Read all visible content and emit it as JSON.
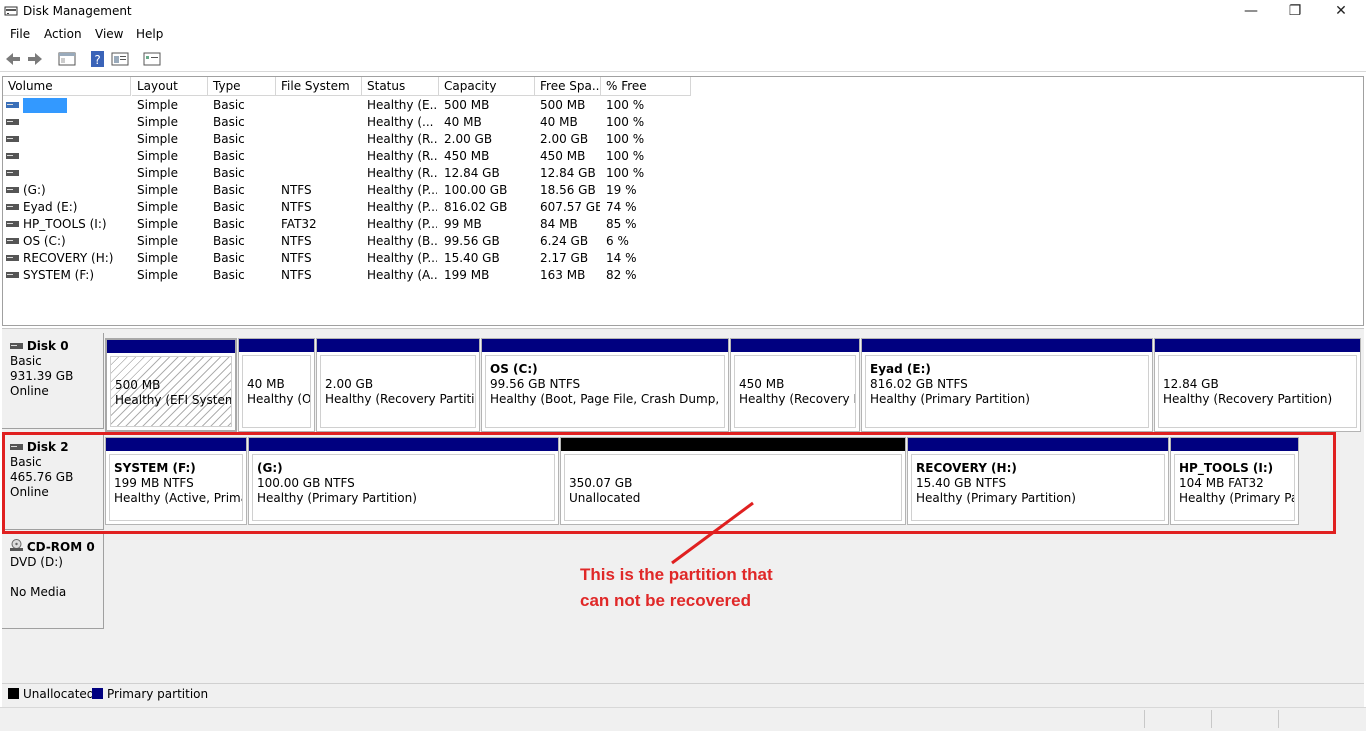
{
  "window": {
    "title": "Disk Management",
    "minimize": "—",
    "maximize": "❐",
    "close": "✕"
  },
  "menu": [
    "File",
    "Action",
    "View",
    "Help"
  ],
  "columns": [
    "Volume",
    "Layout",
    "Type",
    "File System",
    "Status",
    "Capacity",
    "Free Spa...",
    "% Free"
  ],
  "volumes": [
    {
      "volume": "",
      "layout": "Simple",
      "type": "Basic",
      "fs": "",
      "status": "Healthy (E...",
      "capacity": "500 MB",
      "free": "500 MB",
      "pct": "100 %"
    },
    {
      "volume": "",
      "layout": "Simple",
      "type": "Basic",
      "fs": "",
      "status": "Healthy (...",
      "capacity": "40 MB",
      "free": "40 MB",
      "pct": "100 %"
    },
    {
      "volume": "",
      "layout": "Simple",
      "type": "Basic",
      "fs": "",
      "status": "Healthy (R...",
      "capacity": "2.00 GB",
      "free": "2.00 GB",
      "pct": "100 %"
    },
    {
      "volume": "",
      "layout": "Simple",
      "type": "Basic",
      "fs": "",
      "status": "Healthy (R...",
      "capacity": "450 MB",
      "free": "450 MB",
      "pct": "100 %"
    },
    {
      "volume": "",
      "layout": "Simple",
      "type": "Basic",
      "fs": "",
      "status": "Healthy (R...",
      "capacity": "12.84 GB",
      "free": "12.84 GB",
      "pct": "100 %"
    },
    {
      "volume": "(G:)",
      "layout": "Simple",
      "type": "Basic",
      "fs": "NTFS",
      "status": "Healthy (P...",
      "capacity": "100.00 GB",
      "free": "18.56 GB",
      "pct": "19 %"
    },
    {
      "volume": "Eyad (E:)",
      "layout": "Simple",
      "type": "Basic",
      "fs": "NTFS",
      "status": "Healthy (P...",
      "capacity": "816.02 GB",
      "free": "607.57 GB",
      "pct": "74 %"
    },
    {
      "volume": "HP_TOOLS (I:)",
      "layout": "Simple",
      "type": "Basic",
      "fs": "FAT32",
      "status": "Healthy (P...",
      "capacity": "99 MB",
      "free": "84 MB",
      "pct": "85 %"
    },
    {
      "volume": "OS (C:)",
      "layout": "Simple",
      "type": "Basic",
      "fs": "NTFS",
      "status": "Healthy (B...",
      "capacity": "99.56 GB",
      "free": "6.24 GB",
      "pct": "6 %"
    },
    {
      "volume": "RECOVERY (H:)",
      "layout": "Simple",
      "type": "Basic",
      "fs": "NTFS",
      "status": "Healthy (P...",
      "capacity": "15.40 GB",
      "free": "2.17 GB",
      "pct": "14 %"
    },
    {
      "volume": "SYSTEM (F:)",
      "layout": "Simple",
      "type": "Basic",
      "fs": "NTFS",
      "status": "Healthy (A...",
      "capacity": "199 MB",
      "free": "163 MB",
      "pct": "82 %"
    }
  ],
  "disks": [
    {
      "name": "Disk 0",
      "type": "Basic",
      "size": "931.39 GB",
      "state": "Online",
      "partitions": [
        {
          "title": "",
          "line1": "500 MB",
          "line2": "Healthy (EFI System Pa"
        },
        {
          "title": "",
          "line1": "40 MB",
          "line2": "Healthy (OE"
        },
        {
          "title": "",
          "line1": "2.00 GB",
          "line2": "Healthy (Recovery Partition)"
        },
        {
          "title": "OS  (C:)",
          "line1": "99.56 GB NTFS",
          "line2": "Healthy (Boot, Page File, Crash Dump, Prima"
        },
        {
          "title": "",
          "line1": "450 MB",
          "line2": "Healthy (Recovery Par"
        },
        {
          "title": "Eyad  (E:)",
          "line1": "816.02 GB NTFS",
          "line2": "Healthy (Primary Partition)"
        },
        {
          "title": "",
          "line1": "12.84 GB",
          "line2": "Healthy (Recovery Partition)"
        }
      ]
    },
    {
      "name": "Disk 2",
      "type": "Basic",
      "size": "465.76 GB",
      "state": "Online",
      "partitions": [
        {
          "title": "SYSTEM  (F:)",
          "line1": "199 MB NTFS",
          "line2": "Healthy (Active, Primary"
        },
        {
          "title": " (G:)",
          "line1": "100.00 GB NTFS",
          "line2": "Healthy (Primary Partition)"
        },
        {
          "title": "",
          "line1": "350.07 GB",
          "line2": "Unallocated"
        },
        {
          "title": "RECOVERY  (H:)",
          "line1": "15.40 GB NTFS",
          "line2": "Healthy (Primary Partition)"
        },
        {
          "title": "HP_TOOLS  (I:)",
          "line1": "104 MB FAT32",
          "line2": "Healthy (Primary Part"
        }
      ]
    },
    {
      "name": "CD-ROM 0",
      "type": "DVD (D:)",
      "size": "",
      "state": "No Media"
    }
  ],
  "annotation": {
    "line1": "This is the partition that",
    "line2": "can not be recovered"
  },
  "legend": {
    "unallocated": "Unallocated",
    "primary": "Primary partition"
  },
  "colors": {
    "primary": "#000080",
    "unallocated": "#000000",
    "highlight": "#e02020",
    "selection": "#3399ff"
  }
}
